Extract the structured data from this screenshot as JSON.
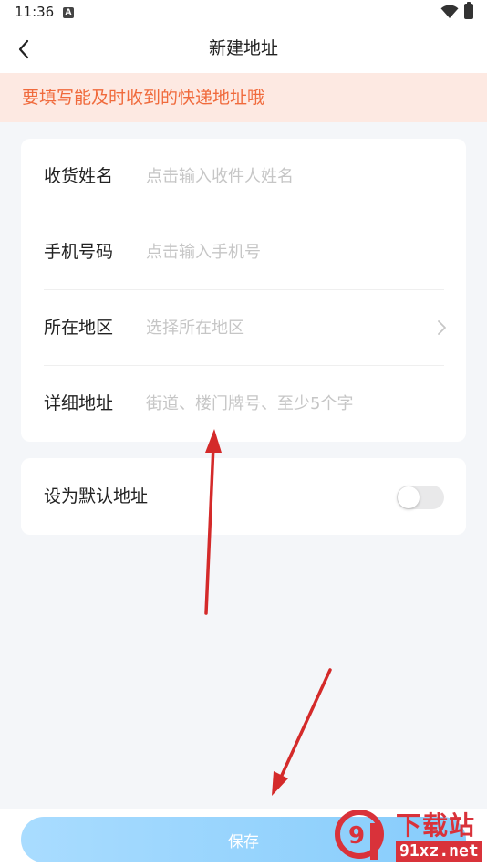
{
  "status_bar": {
    "time": "11:36",
    "notification_icon": "A"
  },
  "header": {
    "title": "新建地址",
    "back_icon": "chevron-left-icon"
  },
  "notice": {
    "text": "要填写能及时收到的快递地址哦",
    "color": "#f06a3c",
    "background": "#fde9e2"
  },
  "form": {
    "fields": [
      {
        "label": "收货姓名",
        "placeholder": "点击输入收件人姓名",
        "value": ""
      },
      {
        "label": "手机号码",
        "placeholder": "点击输入手机号",
        "value": ""
      },
      {
        "label": "所在地区",
        "placeholder": "选择所在地区",
        "value": ""
      },
      {
        "label": "详细地址",
        "placeholder": "街道、楼门牌号、至少5个字",
        "value": ""
      }
    ]
  },
  "default_address": {
    "label": "设为默认地址",
    "enabled": false
  },
  "footer": {
    "save_label": "保存",
    "button_color": "#86ccfb"
  },
  "watermark": {
    "title": "下载站",
    "url": "91xz.net",
    "logo_text": "9"
  },
  "colors": {
    "page_background": "#f4f6f9",
    "annotation_arrow": "#d42a2a"
  }
}
